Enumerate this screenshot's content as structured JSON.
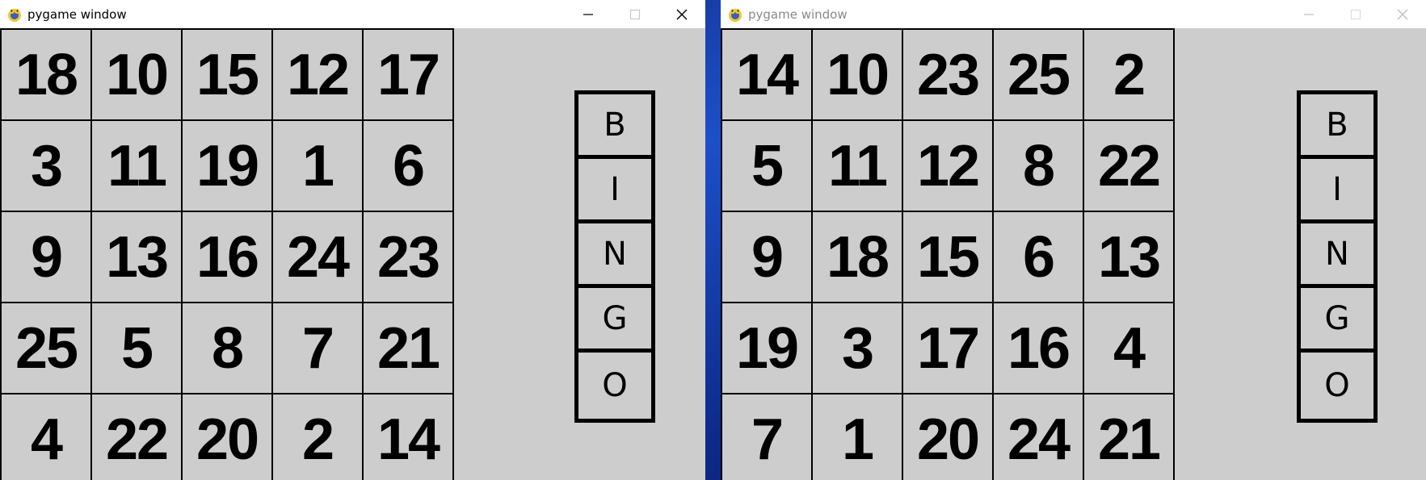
{
  "windows": [
    {
      "title": "pygame window",
      "active": true,
      "board": [
        [
          "18",
          "10",
          "15",
          "12",
          "17"
        ],
        [
          "3",
          "11",
          "19",
          "1",
          "6"
        ],
        [
          "9",
          "13",
          "16",
          "24",
          "23"
        ],
        [
          "25",
          "5",
          "8",
          "7",
          "21"
        ],
        [
          "4",
          "22",
          "20",
          "2",
          "14"
        ]
      ],
      "bingo_letters": [
        "B",
        "I",
        "N",
        "G",
        "O"
      ]
    },
    {
      "title": "pygame window",
      "active": false,
      "board": [
        [
          "14",
          "10",
          "23",
          "25",
          "2"
        ],
        [
          "5",
          "11",
          "12",
          "8",
          "22"
        ],
        [
          "9",
          "18",
          "15",
          "6",
          "13"
        ],
        [
          "19",
          "3",
          "17",
          "16",
          "4"
        ],
        [
          "7",
          "1",
          "20",
          "24",
          "21"
        ]
      ],
      "bingo_letters": [
        "B",
        "I",
        "N",
        "G",
        "O"
      ]
    }
  ],
  "colors": {
    "window_bg": "#cdcdcd",
    "grid_line": "#000000",
    "titlebar_bg": "#ffffff",
    "inactive_title": "#8a8a8a"
  },
  "icons": {
    "app_icon": "pygame-snake-icon",
    "minimize": "minimize-icon",
    "maximize": "maximize-icon",
    "close": "close-icon"
  }
}
